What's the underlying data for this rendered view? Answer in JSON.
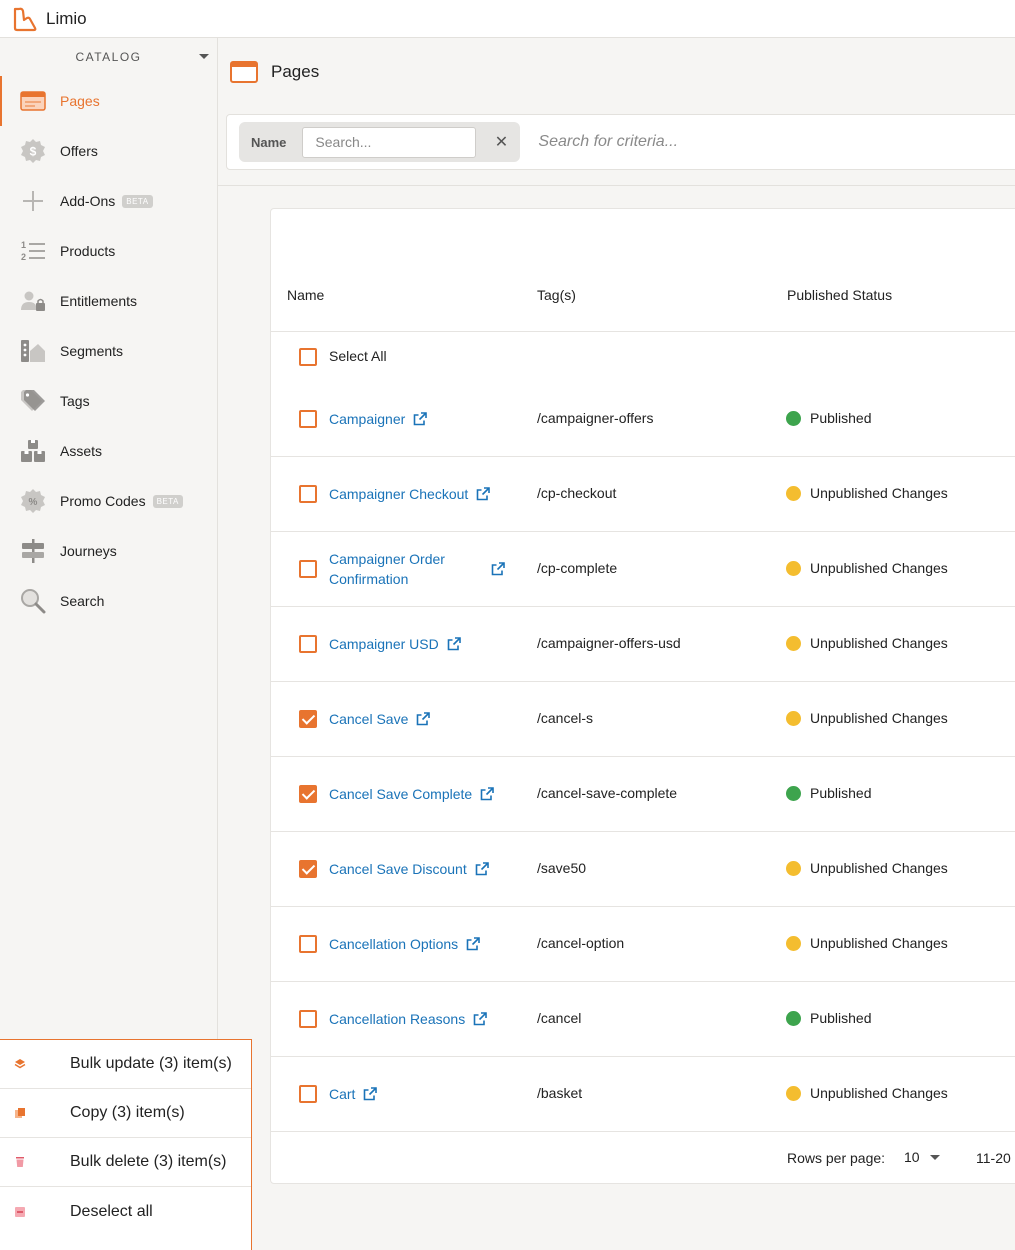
{
  "app": {
    "title": "Limio"
  },
  "sidebar": {
    "section": "CATALOG",
    "items": [
      {
        "label": "Pages",
        "icon": "pages-icon",
        "active": true
      },
      {
        "label": "Offers",
        "icon": "offers-icon"
      },
      {
        "label": "Add-Ons",
        "icon": "add-ons-icon",
        "badge": "BETA"
      },
      {
        "label": "Products",
        "icon": "products-icon"
      },
      {
        "label": "Entitlements",
        "icon": "entitlements-icon"
      },
      {
        "label": "Segments",
        "icon": "segments-icon"
      },
      {
        "label": "Tags",
        "icon": "tags-icon"
      },
      {
        "label": "Assets",
        "icon": "assets-icon"
      },
      {
        "label": "Promo Codes",
        "icon": "promo-codes-icon",
        "badge": "BETA"
      },
      {
        "label": "Journeys",
        "icon": "journeys-icon"
      },
      {
        "label": "Search",
        "icon": "search-icon"
      }
    ]
  },
  "header": {
    "title": "Pages"
  },
  "filter": {
    "chip_label": "Name",
    "placeholder": "Search...",
    "value": "",
    "clear": "✕",
    "criteria_placeholder": "Search for criteria..."
  },
  "table": {
    "columns": [
      "Name",
      "Tag(s)",
      "Published Status"
    ],
    "select_all": "Select All",
    "rows": [
      {
        "name": "Campaigner",
        "tag": "/campaigner-offers",
        "status": "Published",
        "checked": false
      },
      {
        "name": "Campaigner Checkout",
        "tag": "/cp-checkout",
        "status": "Unpublished Changes",
        "checked": false
      },
      {
        "name": "Campaigner Order Confirmation",
        "tag": "/cp-complete",
        "status": "Unpublished Changes",
        "checked": false
      },
      {
        "name": "Campaigner USD",
        "tag": "/campaigner-offers-usd",
        "status": "Unpublished Changes",
        "checked": false
      },
      {
        "name": "Cancel Save",
        "tag": "/cancel-s",
        "status": "Unpublished Changes",
        "checked": true
      },
      {
        "name": "Cancel Save Complete",
        "tag": "/cancel-save-complete",
        "status": "Published",
        "checked": true
      },
      {
        "name": "Cancel Save Discount",
        "tag": "/save50",
        "status": "Unpublished Changes",
        "checked": true
      },
      {
        "name": "Cancellation Options",
        "tag": "/cancel-option",
        "status": "Unpublished Changes",
        "checked": false
      },
      {
        "name": "Cancellation Reasons",
        "tag": "/cancel",
        "status": "Published",
        "checked": false
      },
      {
        "name": "Cart",
        "tag": "/basket",
        "status": "Unpublished Changes",
        "checked": false
      }
    ]
  },
  "pagination": {
    "rows_per_page_label": "Rows per page:",
    "rows_per_page": "10",
    "range": "11-20"
  },
  "bulk_actions": [
    {
      "label": "Bulk update (3) item(s)",
      "icon": "layers-icon"
    },
    {
      "label": "Copy (3) item(s)",
      "icon": "copy-icon"
    },
    {
      "label": "Bulk delete (3) item(s)",
      "icon": "trash-icon"
    },
    {
      "label": "Deselect all",
      "icon": "deselect-icon"
    }
  ],
  "colors": {
    "accent": "#e8742f",
    "link": "#1a73b8",
    "published": "#3da44d",
    "unpublished": "#f4bd2f"
  }
}
